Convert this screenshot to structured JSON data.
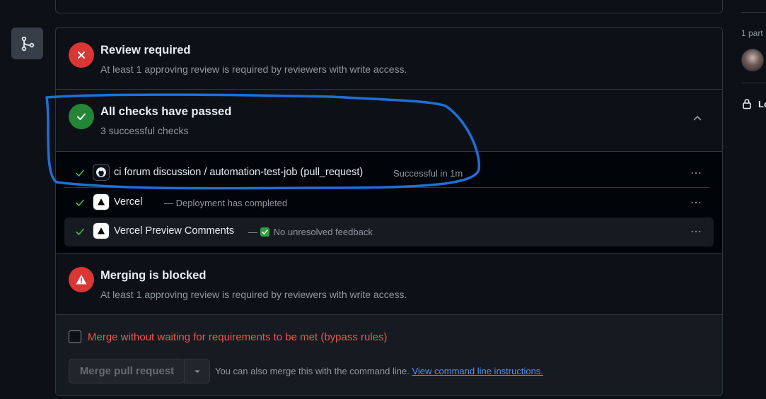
{
  "review": {
    "title": "Review required",
    "subtitle": "At least 1 approving review is required by reviewers with write access."
  },
  "checks": {
    "title": "All checks have passed",
    "subtitle": "3 successful checks",
    "rows": [
      {
        "name": "ci forum discussion / automation-test-job (pull_request)",
        "description": "Successful in 1m",
        "icon": "github-icon"
      },
      {
        "name": "Vercel",
        "description": "— Deployment has completed",
        "icon": "vercel-icon"
      },
      {
        "name": "Vercel Preview Comments",
        "separator": "—",
        "description": "No unresolved feedback",
        "icon": "vercel-icon"
      }
    ]
  },
  "merging": {
    "title": "Merging is blocked",
    "subtitle": "At least 1 approving review is required by reviewers with write access."
  },
  "bypass": {
    "label": "Merge without waiting for requirements to be met (bypass rules)",
    "checked": false
  },
  "merge": {
    "button_label": "Merge pull request",
    "hint": "You can also merge this with the command line.",
    "link": "View command line instructions."
  },
  "sidebar": {
    "participants_label": "1 part",
    "lock_label": "Lo"
  },
  "colors": {
    "background": "#0d1117",
    "border": "#30363d",
    "success": "#238636",
    "danger": "#da3633",
    "danger_text": "#f85149",
    "link": "#4493f8",
    "annotation": "#1f6fd6"
  }
}
